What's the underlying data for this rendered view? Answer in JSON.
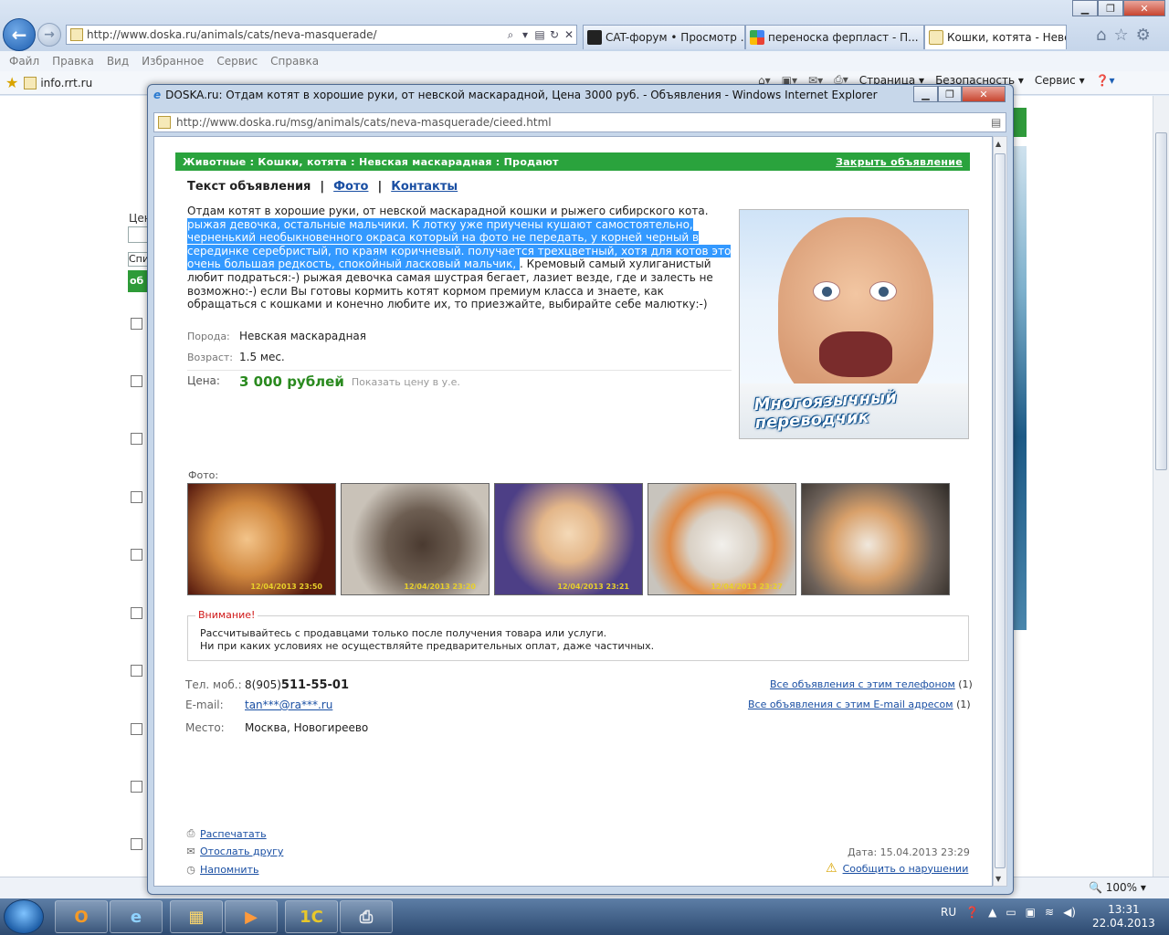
{
  "browser": {
    "url": "http://www.doska.ru/animals/cats/neva-masquerade/",
    "tabs": [
      {
        "label": "CAT-форум • Просмотр ..."
      },
      {
        "label": "переноска ферпласт - П..."
      },
      {
        "label": "Кошки, котята - Невск..."
      }
    ],
    "menu": [
      "Файл",
      "Правка",
      "Вид",
      "Избранное",
      "Сервис",
      "Справка"
    ],
    "favorite": "info.rrt.ru",
    "commands": [
      "Страница",
      "Безопасность",
      "Сервис"
    ],
    "zoom": "100%"
  },
  "background_page": {
    "text_fragment": "Цен",
    "select_fragment": "Спи",
    "green_fragment": "об"
  },
  "popup": {
    "title": "DOSKA.ru: Отдам котят в хорошие руки, от невской маскарадной, Цена 3000 руб. - Объявления - Windows Internet Explorer",
    "url": "http://www.doska.ru/msg/animals/cats/neva-masquerade/cieed.html"
  },
  "ad": {
    "breadcrumb": "Животные : Кошки, котята : Невская маскарадная : Продают",
    "close_label": "Закрыть объявление",
    "tabs": {
      "text": "Текст объявления",
      "photo": "Фото",
      "contacts": "Контакты",
      "separator": "|"
    },
    "description_parts": [
      "Отдам котят в хорошие руки, от невской маскарадной кошки и рыжего сибирского кота.",
      "рыжая девочка, остальные мальчики. К лотку уже приучены кушают самостоятельно, черненький необыкновенного окраса который на фото не передать, у корней черный в серединке серебристый, по краям коричневый. получается трехцветный, хотя для котов это очень большая редкость, спокойный ласковый мальчик, ",
      ". Кремовый самый хулиганистый любит подраться:-) рыжая девочка самая шустрая бегает, лазиет везде, где и залесть не возможно:-) если Вы готовы кормить котят кормом премиум класса и знаете, как обращаться с кошками и конечно любите их, то приезжайте, выбирайте себе малютку:-)"
    ],
    "breed_label": "Порода:",
    "breed": "Невская маскарадная",
    "age_label": "Возраст:",
    "age": "1.5 мес.",
    "price_label": "Цена:",
    "price": "3 000 рублей",
    "price_convert": "Показать цену в у.е.",
    "banner_text": "Многоязычный переводчик",
    "photos_label": "Фото:",
    "photo_dates": [
      "12/04/2013 23:50",
      "12/04/2013 23:20",
      "12/04/2013 23:21",
      "12/04/2013 23:27",
      ""
    ],
    "warning_title": "Внимание!",
    "warning_line1": "Рассчитывайтесь с продавцами только после получения товара или услуги.",
    "warning_line2": "Ни при каких условиях не осуществляйте предварительных оплат, даже частичных.",
    "phone_label": "Тел. моб.:",
    "phone_prefix": "8(905)",
    "phone_number": "511-55-01",
    "email_label": "E-mail:",
    "email": "tan***@ra***.ru",
    "place_label": "Место:",
    "place": "Москва, Новогиреево",
    "all_by_phone": "Все объявления с этим телефоном",
    "all_by_phone_count": "(1)",
    "all_by_email": "Все объявления с этим E-mail адресом",
    "all_by_email_count": "(1)",
    "print": "Распечатать",
    "send_friend": "Отослать другу",
    "remind": "Напомнить",
    "date": "Дата: 15.04.2013 23:29",
    "report": "Сообщить о нарушении"
  },
  "taskbar": {
    "lang": "RU",
    "time": "13:31",
    "date": "22.04.2013"
  },
  "colors": {
    "green_bar": "#2aa33d",
    "link": "#1a4fa3",
    "price": "#2a8a1f",
    "selection": "#3399ff",
    "warning": "#d01818"
  }
}
